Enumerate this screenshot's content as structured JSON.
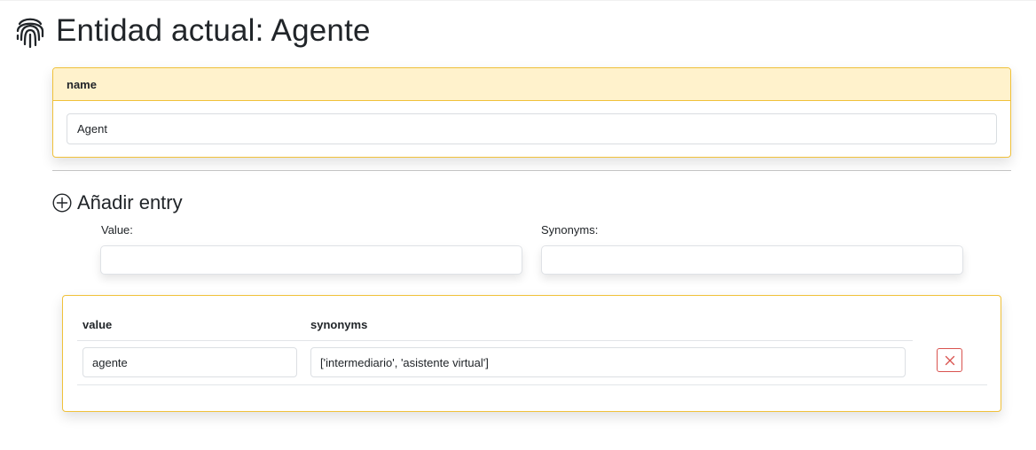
{
  "page": {
    "title": "Entidad actual: Agente",
    "icon": "fingerprint-icon"
  },
  "name_card": {
    "header": "name",
    "value": "Agent"
  },
  "add_entry": {
    "heading": "Añadir entry",
    "icon": "plus-circle-icon",
    "value_label": "Value:",
    "value_input": "",
    "synonyms_label": "Synonyms:",
    "synonyms_input": ""
  },
  "entries_table": {
    "columns": [
      "value",
      "synonyms"
    ],
    "rows": [
      {
        "value": "agente",
        "synonyms": "['intermediario', 'asistente virtual']",
        "delete_icon": "close-icon"
      }
    ]
  },
  "colors": {
    "accent_border": "#f0c13a",
    "header_bg": "#fff2cc",
    "danger": "#d9534f"
  }
}
